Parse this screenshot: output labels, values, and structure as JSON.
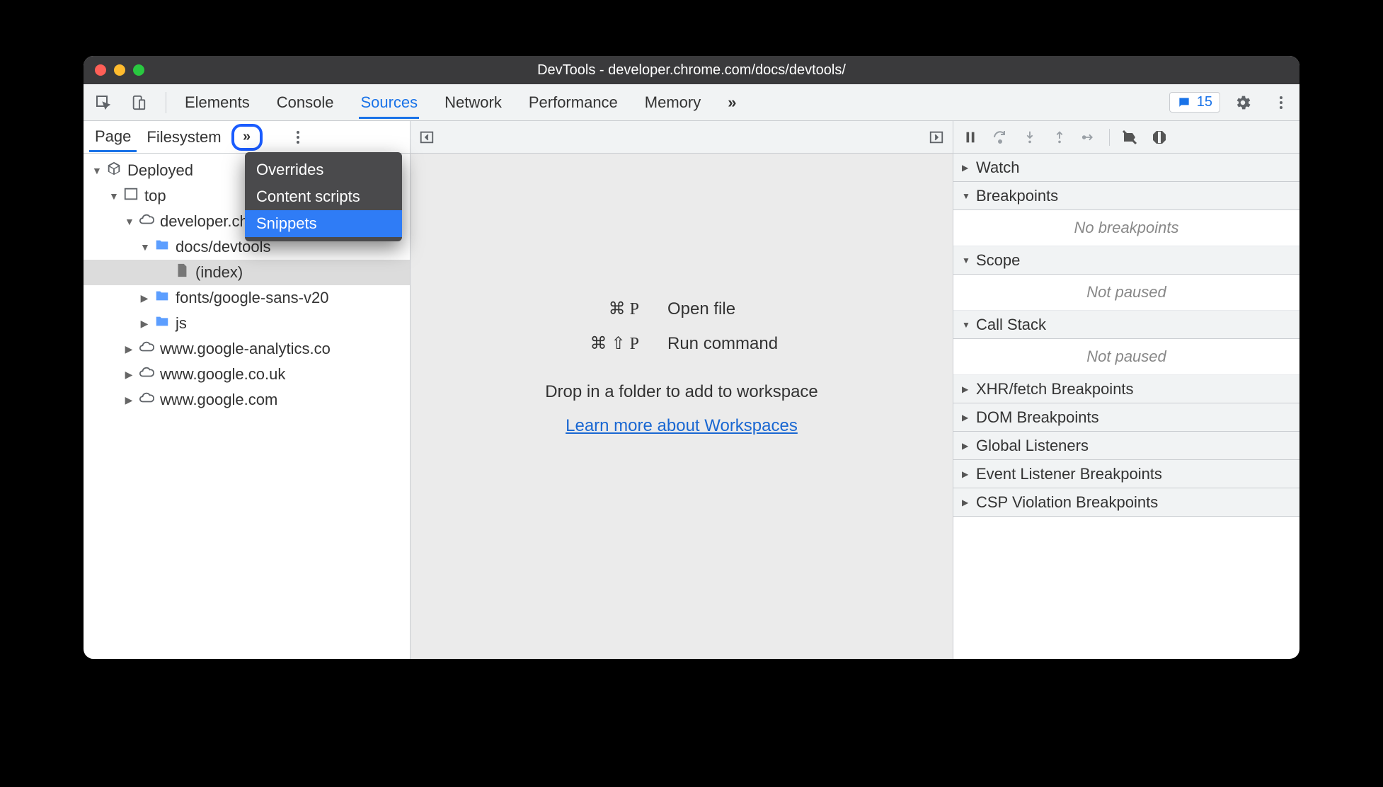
{
  "window": {
    "title": "DevTools - developer.chrome.com/docs/devtools/"
  },
  "main_tabs": [
    "Elements",
    "Console",
    "Sources",
    "Network",
    "Performance",
    "Memory"
  ],
  "main_tabs_active": "Sources",
  "issues_count": "15",
  "sub_tabs": [
    "Page",
    "Filesystem"
  ],
  "sub_tabs_active": "Page",
  "dropdown": {
    "items": [
      "Overrides",
      "Content scripts",
      "Snippets"
    ],
    "highlight": "Snippets"
  },
  "tree": {
    "root": "Deployed",
    "top": "top",
    "origin": "developer.chrome.com",
    "folders": {
      "docs": "docs/devtools",
      "index": "(index)",
      "fonts": "fonts/google-sans-v20",
      "js": "js"
    },
    "externals": [
      "www.google-analytics.co",
      "www.google.co.uk",
      "www.google.com"
    ]
  },
  "center": {
    "open_file_key": "⌘ P",
    "open_file_label": "Open file",
    "run_cmd_key": "⌘ ⇧ P",
    "run_cmd_label": "Run command",
    "drop_msg": "Drop in a folder to add to workspace",
    "learn_more": "Learn more about Workspaces"
  },
  "debugger": {
    "sections": {
      "watch": "Watch",
      "breakpoints": "Breakpoints",
      "breakpoints_empty": "No breakpoints",
      "scope": "Scope",
      "scope_empty": "Not paused",
      "callstack": "Call Stack",
      "callstack_empty": "Not paused",
      "xhr": "XHR/fetch Breakpoints",
      "dom": "DOM Breakpoints",
      "global": "Global Listeners",
      "event": "Event Listener Breakpoints",
      "csp": "CSP Violation Breakpoints"
    }
  }
}
